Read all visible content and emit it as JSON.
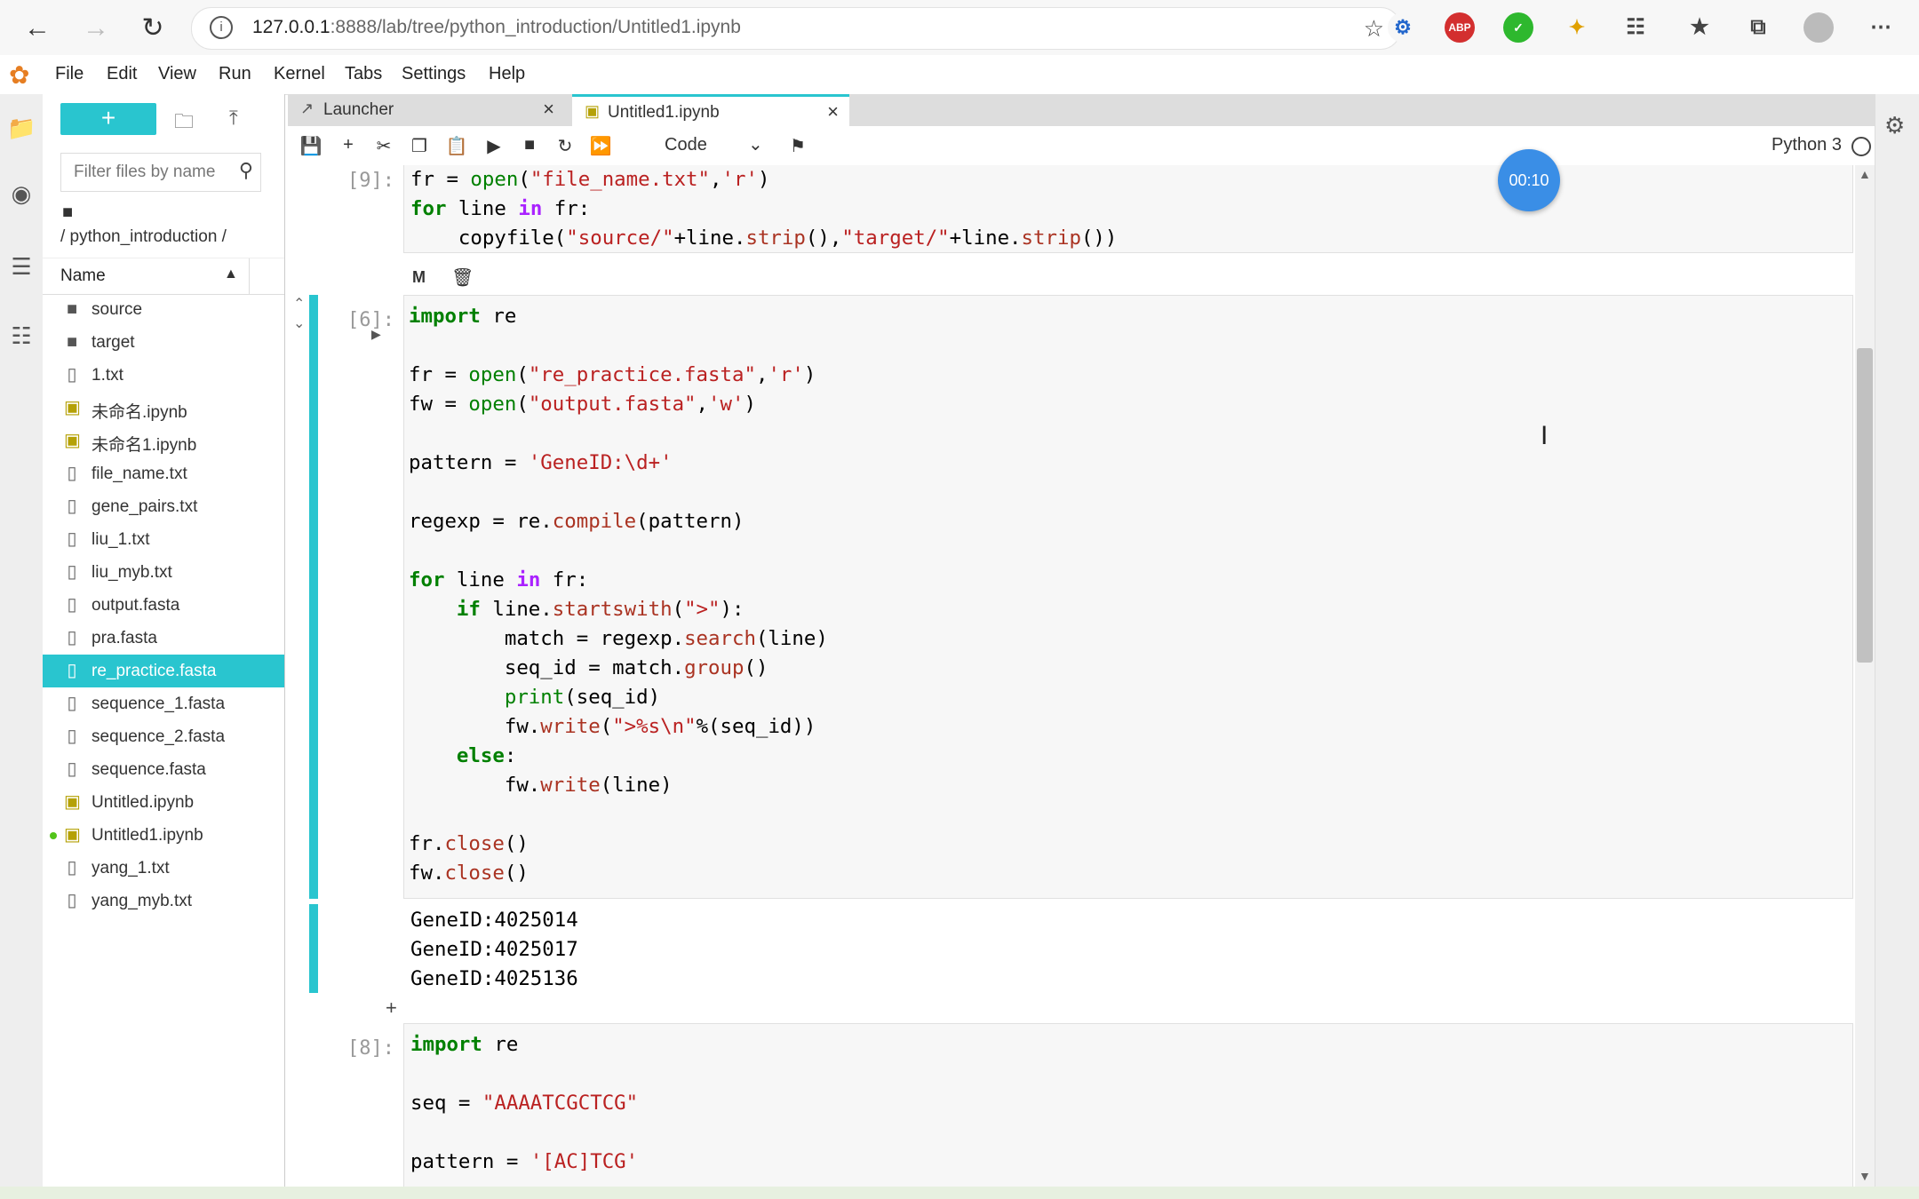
{
  "browser": {
    "url_host": "127.0.0.1",
    "url_rest": ":8888/lab/tree/python_introduction/Untitled1.ipynb",
    "info_icon": "info-icon",
    "extensions": [
      "abp-ext",
      "check-ext",
      "puzzle-ext"
    ],
    "abp_label": "ABP"
  },
  "menu": [
    "File",
    "Edit",
    "View",
    "Run",
    "Kernel",
    "Tabs",
    "Settings",
    "Help"
  ],
  "filebrowser": {
    "new_label": "+",
    "filter_placeholder": "Filter files by name",
    "breadcrumb": "/ python_introduction /",
    "column_name": "Name",
    "files": [
      {
        "name": "source",
        "type": "folder"
      },
      {
        "name": "target",
        "type": "folder"
      },
      {
        "name": "1.txt",
        "type": "file"
      },
      {
        "name": "未命名.ipynb",
        "type": "notebook"
      },
      {
        "name": "未命名1.ipynb",
        "type": "notebook"
      },
      {
        "name": "file_name.txt",
        "type": "file"
      },
      {
        "name": "gene_pairs.txt",
        "type": "file"
      },
      {
        "name": "liu_1.txt",
        "type": "file"
      },
      {
        "name": "liu_myb.txt",
        "type": "file"
      },
      {
        "name": "output.fasta",
        "type": "file"
      },
      {
        "name": "pra.fasta",
        "type": "file"
      },
      {
        "name": "re_practice.fasta",
        "type": "file",
        "selected": true
      },
      {
        "name": "sequence_1.fasta",
        "type": "file"
      },
      {
        "name": "sequence_2.fasta",
        "type": "file"
      },
      {
        "name": "sequence.fasta",
        "type": "file"
      },
      {
        "name": "Untitled.ipynb",
        "type": "notebook"
      },
      {
        "name": "Untitled1.ipynb",
        "type": "notebook",
        "running": true
      },
      {
        "name": "yang_1.txt",
        "type": "file"
      },
      {
        "name": "yang_myb.txt",
        "type": "file"
      }
    ]
  },
  "tabs": [
    {
      "label": "Launcher"
    },
    {
      "label": "Untitled1.ipynb"
    }
  ],
  "toolbar": {
    "cell_type": "Code",
    "kernel_name": "Python 3"
  },
  "timer": "00:10",
  "cells": {
    "c9_prompt": "[9]:",
    "c6_prompt": "[6]:",
    "c8_prompt": "[8]:",
    "c6_output": "GeneID:4025014\nGeneID:4025017\nGeneID:4025136",
    "cell_tool_m": "M"
  },
  "colors": {
    "accent": "#29c5cf",
    "keyword": "#008000",
    "string": "#ba2121"
  }
}
